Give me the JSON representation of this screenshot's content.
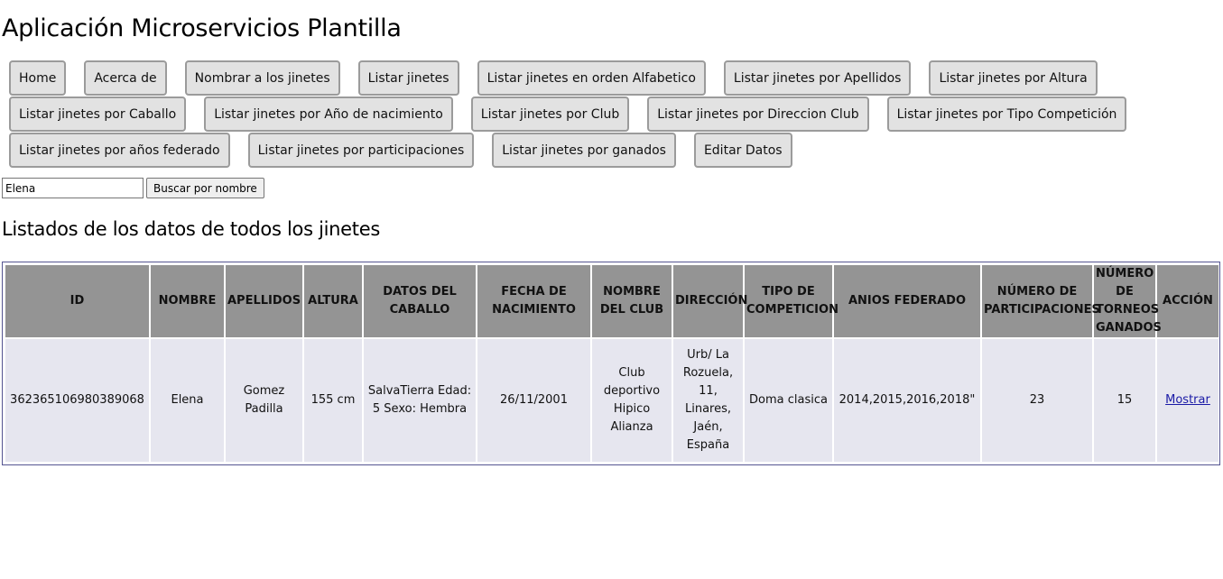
{
  "app": {
    "title": "Aplicación Microservicios Plantilla"
  },
  "nav": {
    "rows": [
      [
        "Home",
        "Acerca de",
        "Nombrar a los jinetes",
        "Listar jinetes",
        "Listar jinetes en orden Alfabetico",
        "Listar jinetes por Apellidos",
        "Listar jinetes por Altura"
      ],
      [
        "Listar jinetes por Caballo",
        "Listar jinetes por Año de nacimiento",
        "Listar jinetes por Club",
        "Listar jinetes por Direccion Club",
        "Listar jinetes por Tipo Competición"
      ],
      [
        "Listar jinetes por años federado",
        "Listar jinetes por participaciones",
        "Listar jinetes por ganados",
        "Editar Datos"
      ]
    ]
  },
  "search": {
    "value": "Elena",
    "button_label": "Buscar por nombre"
  },
  "section": {
    "title": "Listados de los datos de todos los jinetes"
  },
  "table": {
    "headers": [
      "ID",
      "NOMBRE",
      "APELLIDOS",
      "ALTURA",
      "DATOS DEL CABALLO",
      "FECHA DE NACIMIENTO",
      "NOMBRE DEL CLUB",
      "DIRECCIÓN",
      "TIPO DE COMPETICION",
      "ANIOS FEDERADO",
      "NÚMERO DE PARTICIPACIONES",
      "NÚMERO DE TORNEOS GANADOS",
      "ACCIÓN"
    ],
    "rows": [
      {
        "id": "362365106980389068",
        "nombre": "Elena",
        "apellidos": "Gomez Padilla",
        "altura": "155 cm",
        "caballo": "SalvaTierra Edad: 5 Sexo: Hembra",
        "fecha": "26/11/2001",
        "club": "Club deportivo Hipico Alianza",
        "direccion": "Urb/ La Rozuela, 11, Linares, Jaén, España",
        "tipo": "Doma clasica",
        "anios": "2014,2015,2016,2018\"",
        "participaciones": "23",
        "ganados": "15",
        "accion": "Mostrar"
      }
    ]
  }
}
